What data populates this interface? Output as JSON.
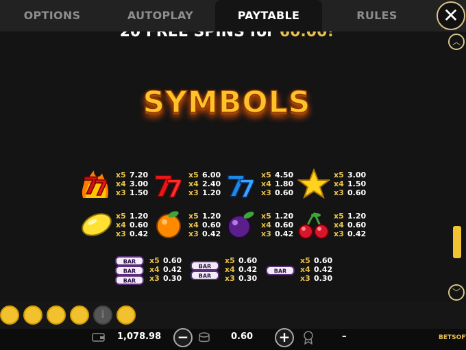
{
  "tabs": [
    {
      "label": "OPTIONS"
    },
    {
      "label": "AUTOPLAY"
    },
    {
      "label": "PAYTABLE",
      "active": true
    },
    {
      "label": "RULES"
    }
  ],
  "close_icon": "close-icon",
  "clipped_line": {
    "prefix": "20 FREE SPINS for ",
    "amount": "60.00!"
  },
  "section_title": "SYMBOLS",
  "paytable": {
    "row1": [
      {
        "symbol": "flaming-seven",
        "pays": [
          {
            "m": "x5",
            "v": "7.20"
          },
          {
            "m": "x4",
            "v": "3.00"
          },
          {
            "m": "x3",
            "v": "1.50"
          }
        ]
      },
      {
        "symbol": "red-seven",
        "pays": [
          {
            "m": "x5",
            "v": "6.00"
          },
          {
            "m": "x4",
            "v": "2.40"
          },
          {
            "m": "x3",
            "v": "1.20"
          }
        ]
      },
      {
        "symbol": "blue-seven",
        "pays": [
          {
            "m": "x5",
            "v": "4.50"
          },
          {
            "m": "x4",
            "v": "1.80"
          },
          {
            "m": "x3",
            "v": "0.60"
          }
        ]
      },
      {
        "symbol": "star",
        "pays": [
          {
            "m": "x5",
            "v": "3.00"
          },
          {
            "m": "x4",
            "v": "1.50"
          },
          {
            "m": "x3",
            "v": "0.60"
          }
        ]
      }
    ],
    "row2": [
      {
        "symbol": "lemon",
        "pays": [
          {
            "m": "x5",
            "v": "1.20"
          },
          {
            "m": "x4",
            "v": "0.60"
          },
          {
            "m": "x3",
            "v": "0.42"
          }
        ]
      },
      {
        "symbol": "orange",
        "pays": [
          {
            "m": "x5",
            "v": "1.20"
          },
          {
            "m": "x4",
            "v": "0.60"
          },
          {
            "m": "x3",
            "v": "0.42"
          }
        ]
      },
      {
        "symbol": "plum",
        "pays": [
          {
            "m": "x5",
            "v": "1.20"
          },
          {
            "m": "x4",
            "v": "0.60"
          },
          {
            "m": "x3",
            "v": "0.42"
          }
        ]
      },
      {
        "symbol": "cherries",
        "pays": [
          {
            "m": "x5",
            "v": "1.20"
          },
          {
            "m": "x4",
            "v": "0.60"
          },
          {
            "m": "x3",
            "v": "0.42"
          }
        ]
      }
    ],
    "row3": [
      {
        "symbol": "triple-bar",
        "pays": [
          {
            "m": "x5",
            "v": "0.60"
          },
          {
            "m": "x4",
            "v": "0.42"
          },
          {
            "m": "x3",
            "v": "0.30"
          }
        ]
      },
      {
        "symbol": "double-bar",
        "pays": [
          {
            "m": "x5",
            "v": "0.60"
          },
          {
            "m": "x4",
            "v": "0.42"
          },
          {
            "m": "x3",
            "v": "0.30"
          }
        ]
      },
      {
        "symbol": "single-bar",
        "pays": [
          {
            "m": "x5",
            "v": "0.60"
          },
          {
            "m": "x4",
            "v": "0.42"
          },
          {
            "m": "x3",
            "v": "0.30"
          }
        ]
      }
    ],
    "bar_label": "BAR"
  },
  "scroll": {
    "up_icon": "chevron-up-icon",
    "down_icon": "chevron-down-icon",
    "position": 0.86
  },
  "toolbar": {
    "icons": [
      "home-icon",
      "back-icon",
      "settings-icon",
      "forward-icon",
      "info-icon",
      "help-icon"
    ],
    "info_glyph": "i",
    "help_glyph": "?",
    "balance": "1,078.98",
    "bet": "0.60",
    "win": "–",
    "minus": "−",
    "plus": "+",
    "brand": "BETSOFT"
  },
  "colors": {
    "accent": "#f2c12e",
    "gold_text": "#e9c24c",
    "background": "#141414"
  }
}
